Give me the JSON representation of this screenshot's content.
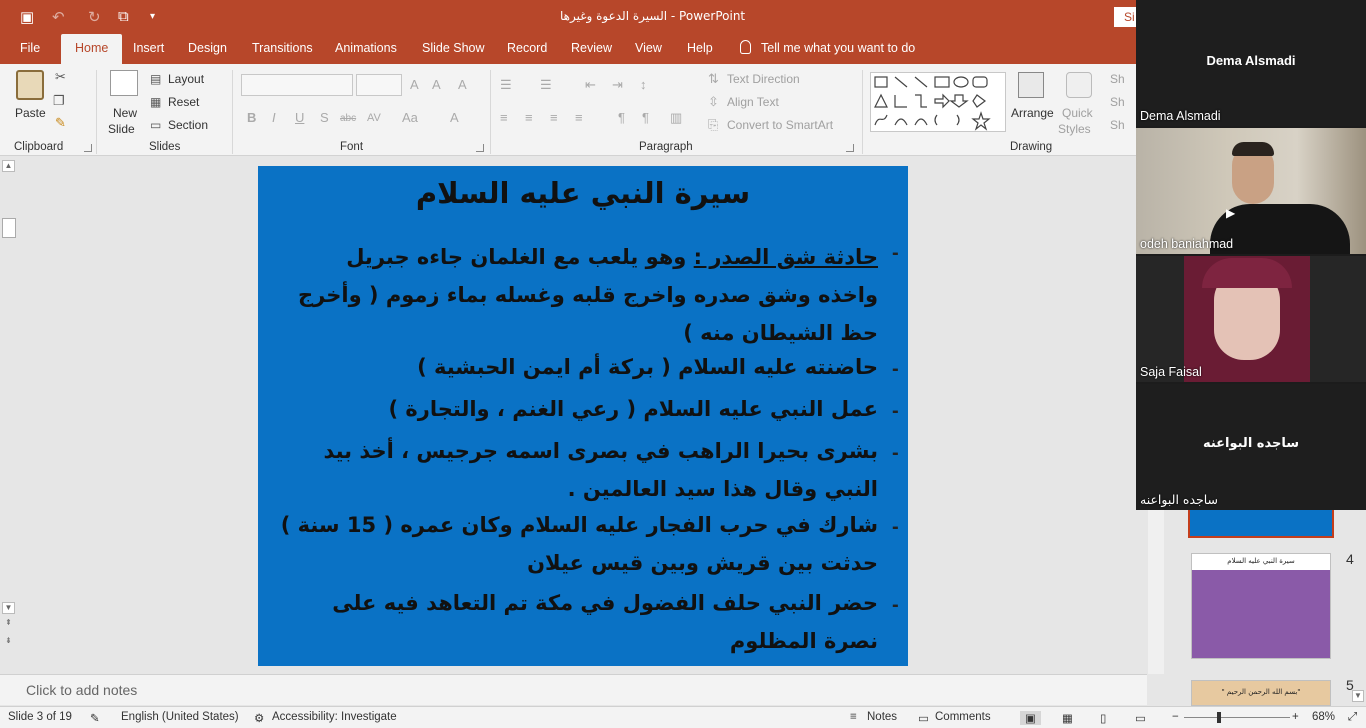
{
  "app": {
    "title": "السيرة الدعوة وغيرها  -  PowerPoint",
    "signin_label": "Si",
    "accent": "#b7472a"
  },
  "tabs": [
    "File",
    "Home",
    "Insert",
    "Design",
    "Transitions",
    "Animations",
    "Slide Show",
    "Record",
    "Review",
    "View",
    "Help"
  ],
  "active_tab": "Home",
  "tell_me": "Tell me what you want to do",
  "ribbon": {
    "clipboard": {
      "paste": "Paste",
      "group": "Clipboard"
    },
    "slides": {
      "new_slide_1": "New",
      "new_slide_2": "Slide",
      "layout": "Layout",
      "reset": "Reset",
      "section": "Section",
      "group": "Slides"
    },
    "font": {
      "group": "Font"
    },
    "paragraph": {
      "text_direction": "Text Direction",
      "align_text": "Align Text",
      "convert_smartart": "Convert to SmartArt",
      "group": "Paragraph"
    },
    "drawing": {
      "arrange": "Arrange",
      "quick_styles_1": "Quick",
      "quick_styles_2": "Styles",
      "group": "Drawing",
      "sh1": "Sh",
      "sh2": "Sh",
      "sh3": "Sh"
    }
  },
  "slide": {
    "background": "#0a72c5",
    "title": "سيرة النبي عليه السلام",
    "bullets": [
      {
        "underlined": "حادثة شق الصدر :",
        "text": " وهو يلعب مع الغلمان جاءه جبريل واخذه وشق صدره واخرج قلبه وغسله بماء زموم ( وأخرج حظ الشيطان منه )"
      },
      {
        "underlined": "",
        "text": "حاضنته عليه السلام ( بركة أم ايمن الحبشية )"
      },
      {
        "underlined": "",
        "text": "عمل النبي عليه السلام ( رعي الغنم ، والتجارة )"
      },
      {
        "underlined": "",
        "text": "بشرى بحيرا الراهب في بصرى اسمه جرجيس ، أخذ بيد النبي وقال هذا سيد العالمين ."
      },
      {
        "underlined": "",
        "text": "شارك في حرب الفجار عليه السلام وكان عمره ( 15 سنة ) حدثت بين قريش وبين قيس عيلان"
      },
      {
        "underlined": "",
        "text": "حضر النبي حلف الفضول في مكة تم التعاهد فيه على نصرة المظلوم"
      }
    ]
  },
  "notes_placeholder": "Click to add notes",
  "status": {
    "slide_info": "Slide 3 of 19",
    "language": "English (United States)",
    "accessibility": "Accessibility: Investigate",
    "notes": "Notes",
    "comments": "Comments",
    "zoom": "68%"
  },
  "thumbnails": [
    {
      "number": "4",
      "title": "سيرة النبي عليه السلام",
      "color": "#8a5aa8"
    },
    {
      "number": "5",
      "title": "\"بسم الله الرحمن الرحيم \"",
      "color": "#e7c9a0"
    }
  ],
  "participants": [
    {
      "name": "Dema Alsmadi",
      "center_label": "Dema Alsmadi",
      "video": false
    },
    {
      "name": "odeh baniahmad",
      "center_label": "",
      "video": true
    },
    {
      "name": "Saja Faisal",
      "center_label": "",
      "video": true
    },
    {
      "name": "ساجده البواعنه",
      "center_label": "ساجده البواعنه",
      "video": false
    }
  ]
}
